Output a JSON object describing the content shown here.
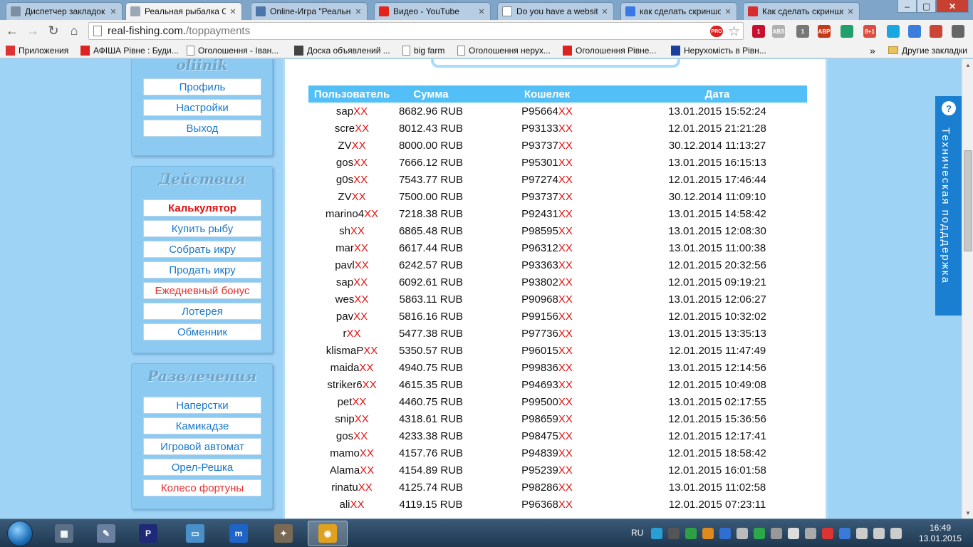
{
  "tabs": [
    {
      "label": "Диспетчер закладок",
      "icon": "star-icon",
      "color": "#7c8fa3",
      "active": false
    },
    {
      "label": "Реальная рыбалка Он",
      "icon": "fish-icon",
      "color": "#9aa8b5",
      "active": true
    },
    {
      "label": "Online-Игра \"Реальна",
      "icon": "vk-icon",
      "color": "#4a76a8",
      "active": false
    },
    {
      "label": "Видео - YouTube",
      "icon": "youtube-icon",
      "color": "#e62117",
      "active": false
    },
    {
      "label": "Do you have a website",
      "icon": "doc-icon",
      "color": "#ffffff",
      "active": false
    },
    {
      "label": "как сделать скриншо",
      "icon": "google-icon",
      "color": "#3b78e7",
      "active": false
    },
    {
      "label": "Как сделать скриншо",
      "icon": "bookmark-icon",
      "color": "#d92d2d",
      "active": false
    }
  ],
  "toolbar": {
    "url_host": "real-fishing.com.",
    "url_path": "/toppayments",
    "pro_badge": "PRO",
    "extensions": [
      "1",
      "ABS",
      "1",
      "ABP",
      "",
      "8+1",
      "",
      "",
      "",
      ""
    ]
  },
  "bookmarks": [
    {
      "label": "Приложения",
      "icon": "apps-icon"
    },
    {
      "label": "АФІША Рівне : Буди...",
      "icon": "afisha-icon"
    },
    {
      "label": "Оголошення - Іван...",
      "icon": "doc-icon"
    },
    {
      "label": "Доска объявлений ...",
      "icon": "olx-icon"
    },
    {
      "label": "big farm",
      "icon": "doc-icon"
    },
    {
      "label": "Оголошення нерух...",
      "icon": "doc-icon"
    },
    {
      "label": "Оголошення Рівне...",
      "icon": "ria-icon"
    },
    {
      "label": "Нерухомість в Рівн...",
      "icon": "dom-icon"
    }
  ],
  "bookmarks_more": "»",
  "bookmarks_other": "Другие закладки",
  "sidebar": {
    "profile": {
      "title": "oliinik",
      "items": [
        {
          "label": "Профиль",
          "style": "normal"
        },
        {
          "label": "Настройки",
          "style": "normal"
        },
        {
          "label": "Выход",
          "style": "normal"
        }
      ]
    },
    "actions": {
      "title": "Действия",
      "items": [
        {
          "label": "Калькулятор",
          "style": "bold"
        },
        {
          "label": "Купить рыбу",
          "style": "normal"
        },
        {
          "label": "Собрать икру",
          "style": "normal"
        },
        {
          "label": "Продать икру",
          "style": "normal"
        },
        {
          "label": "Ежедневный бонус",
          "style": "red"
        },
        {
          "label": "Лотерея",
          "style": "normal"
        },
        {
          "label": "Обменник",
          "style": "normal"
        }
      ]
    },
    "fun": {
      "title": "Развлечения",
      "items": [
        {
          "label": "Наперстки",
          "style": "normal"
        },
        {
          "label": "Камикадзе",
          "style": "normal"
        },
        {
          "label": "Игровой автомат",
          "style": "normal"
        },
        {
          "label": "Орел-Решка",
          "style": "normal"
        },
        {
          "label": "Колесо фортуны",
          "style": "red"
        }
      ]
    }
  },
  "table": {
    "headers": [
      "Пользователь",
      "Сумма",
      "Кошелек",
      "Дата"
    ],
    "mask": "XX",
    "rows": [
      {
        "user": "sap",
        "sum": "8682.96 RUB",
        "wallet": "P95664",
        "date": "13.01.2015 15:52:24"
      },
      {
        "user": "scre",
        "sum": "8012.43 RUB",
        "wallet": "P93133",
        "date": "12.01.2015 21:21:28"
      },
      {
        "user": "ZV",
        "sum": "8000.00 RUB",
        "wallet": "P93737",
        "date": "30.12.2014 11:13:27"
      },
      {
        "user": "gos",
        "sum": "7666.12 RUB",
        "wallet": "P95301",
        "date": "13.01.2015 16:15:13"
      },
      {
        "user": "g0s",
        "sum": "7543.77 RUB",
        "wallet": "P97274",
        "date": "12.01.2015 17:46:44"
      },
      {
        "user": "ZV",
        "sum": "7500.00 RUB",
        "wallet": "P93737",
        "date": "30.12.2014 11:09:10"
      },
      {
        "user": "marino4",
        "sum": "7218.38 RUB",
        "wallet": "P92431",
        "date": "13.01.2015 14:58:42"
      },
      {
        "user": "sh",
        "sum": "6865.48 RUB",
        "wallet": "P98595",
        "date": "13.01.2015 12:08:30"
      },
      {
        "user": "mar",
        "sum": "6617.44 RUB",
        "wallet": "P96312",
        "date": "13.01.2015 11:00:38"
      },
      {
        "user": "pavl",
        "sum": "6242.57 RUB",
        "wallet": "P93363",
        "date": "12.01.2015 20:32:56"
      },
      {
        "user": "sap",
        "sum": "6092.61 RUB",
        "wallet": "P93802",
        "date": "12.01.2015 09:19:21"
      },
      {
        "user": "wes",
        "sum": "5863.11 RUB",
        "wallet": "P90968",
        "date": "13.01.2015 12:06:27"
      },
      {
        "user": "pav",
        "sum": "5816.16 RUB",
        "wallet": "P99156",
        "date": "12.01.2015 10:32:02"
      },
      {
        "user": "r",
        "sum": "5477.38 RUB",
        "wallet": "P97736",
        "date": "13.01.2015 13:35:13"
      },
      {
        "user": "klismaP",
        "sum": "5350.57 RUB",
        "wallet": "P96015",
        "date": "12.01.2015 11:47:49"
      },
      {
        "user": "maida",
        "sum": "4940.75 RUB",
        "wallet": "P99836",
        "date": "13.01.2015 12:14:56"
      },
      {
        "user": "striker6",
        "sum": "4615.35 RUB",
        "wallet": "P94693",
        "date": "12.01.2015 10:49:08"
      },
      {
        "user": "pet",
        "sum": "4460.75 RUB",
        "wallet": "P99500",
        "date": "13.01.2015 02:17:55"
      },
      {
        "user": "snip",
        "sum": "4318.61 RUB",
        "wallet": "P98659",
        "date": "12.01.2015 15:36:56"
      },
      {
        "user": "gos",
        "sum": "4233.38 RUB",
        "wallet": "P98475",
        "date": "12.01.2015 12:17:41"
      },
      {
        "user": "mamo",
        "sum": "4157.76 RUB",
        "wallet": "P94839",
        "date": "12.01.2015 18:58:42"
      },
      {
        "user": "Alama",
        "sum": "4154.89 RUB",
        "wallet": "P95239",
        "date": "12.01.2015 16:01:58"
      },
      {
        "user": "rinatu",
        "sum": "4125.74 RUB",
        "wallet": "P98286",
        "date": "13.01.2015 11:02:58"
      },
      {
        "user": "ali",
        "sum": "4119.15 RUB",
        "wallet": "P96368",
        "date": "12.01.2015 07:23:11"
      }
    ]
  },
  "support": {
    "label": "Техническая подддержка",
    "icon": "chat-icon"
  },
  "taskbar": {
    "apps": [
      {
        "name": "device-manager-icon",
        "color": "#5a6f85",
        "glyph": "▦"
      },
      {
        "name": "paint-icon",
        "color": "#6b7fa0",
        "glyph": "✎"
      },
      {
        "name": "pascal-icon",
        "color": "#1e2a78",
        "glyph": "P"
      },
      {
        "name": "computer-icon",
        "color": "#4a90c8",
        "glyph": "▭"
      },
      {
        "name": "maxthon-icon",
        "color": "#1e64c8",
        "glyph": "m"
      },
      {
        "name": "gimp-icon",
        "color": "#7a6a55",
        "glyph": "✦"
      },
      {
        "name": "chrome-icon",
        "color": "#e0a020",
        "glyph": "◉"
      }
    ],
    "lang": "RU",
    "time": "16:49",
    "date": "13.01.2015"
  },
  "colors": {
    "page_bg": "#9fd3f5",
    "header_bg": "#52c0f7",
    "link": "#1a78c9",
    "mask": "#e81010",
    "support_bg": "#1a7fd1"
  }
}
